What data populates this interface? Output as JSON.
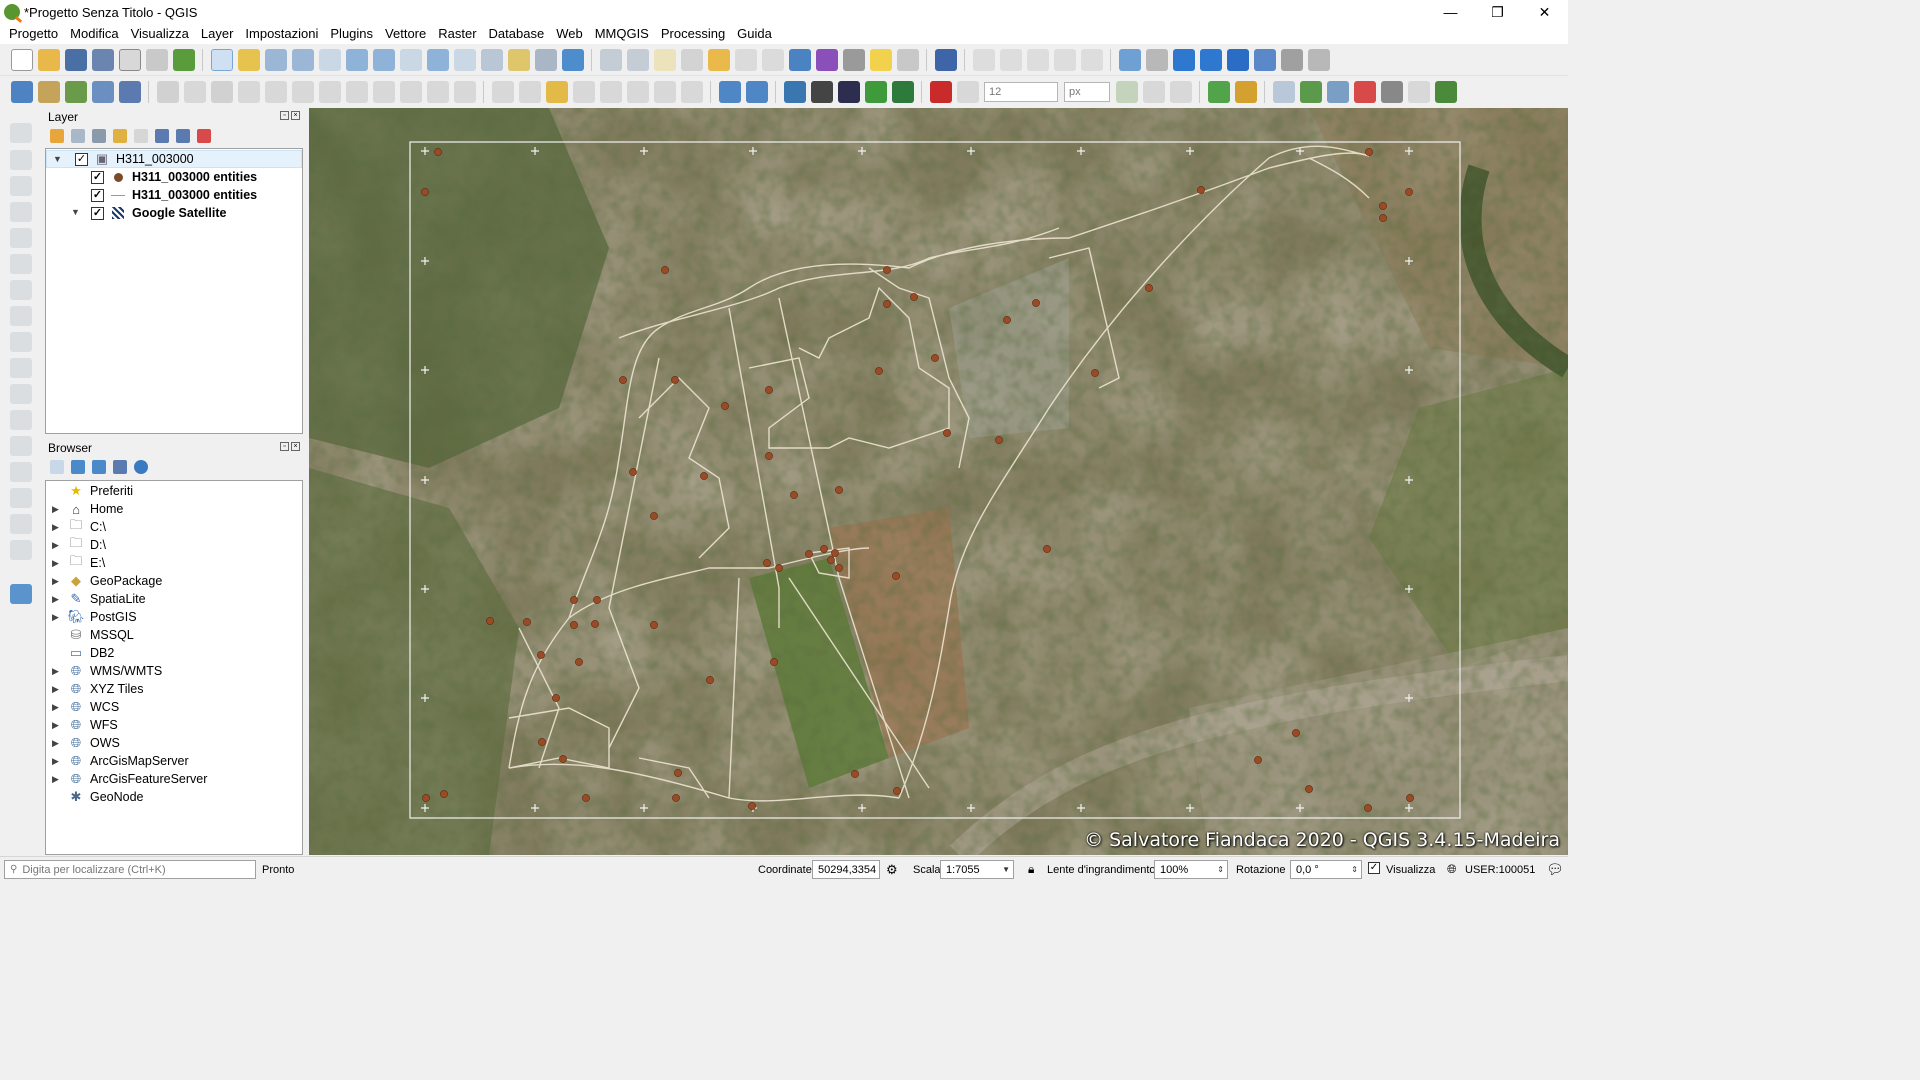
{
  "window": {
    "title": "*Progetto Senza Titolo - QGIS",
    "minimize": "—",
    "restore": "❐",
    "close": "✕"
  },
  "menubar": [
    "Progetto",
    "Modifica",
    "Visualizza",
    "Layer",
    "Impostazioni",
    "Plugins",
    "Vettore",
    "Raster",
    "Database",
    "Web",
    "MMQGIS",
    "Processing",
    "Guida"
  ],
  "toolbar2": {
    "size_value": "12",
    "unit_value": "px"
  },
  "layers_panel": {
    "title": "Layer",
    "items": [
      {
        "label": "H311_003000",
        "checked": true,
        "bold": false,
        "icon": "group-icon"
      },
      {
        "label": "H311_003000 entities",
        "checked": true,
        "bold": true,
        "icon": "point-layer-icon"
      },
      {
        "label": "H311_003000 entities",
        "checked": true,
        "bold": true,
        "icon": "line-layer-icon"
      },
      {
        "label": "Google Satellite",
        "checked": true,
        "bold": true,
        "icon": "raster-layer-icon"
      }
    ]
  },
  "browser_panel": {
    "title": "Browser",
    "items": [
      {
        "label": "Preferiti",
        "icon": "star-icon",
        "expandable": false
      },
      {
        "label": "Home",
        "icon": "home-icon",
        "expandable": true
      },
      {
        "label": "C:\\",
        "icon": "folder-icon",
        "expandable": true
      },
      {
        "label": "D:\\",
        "icon": "folder-icon",
        "expandable": true
      },
      {
        "label": "E:\\",
        "icon": "folder-icon",
        "expandable": true
      },
      {
        "label": "GeoPackage",
        "icon": "geopackage-icon",
        "expandable": true
      },
      {
        "label": "SpatiaLite",
        "icon": "spatialite-icon",
        "expandable": true
      },
      {
        "label": "PostGIS",
        "icon": "postgis-icon",
        "expandable": true
      },
      {
        "label": "MSSQL",
        "icon": "mssql-icon",
        "expandable": false
      },
      {
        "label": "DB2",
        "icon": "db2-icon",
        "expandable": false
      },
      {
        "label": "WMS/WMTS",
        "icon": "globe-icon",
        "expandable": true
      },
      {
        "label": "XYZ Tiles",
        "icon": "globe-icon",
        "expandable": true
      },
      {
        "label": "WCS",
        "icon": "globe-icon",
        "expandable": true
      },
      {
        "label": "WFS",
        "icon": "globe-icon",
        "expandable": true
      },
      {
        "label": "OWS",
        "icon": "globe-icon",
        "expandable": true
      },
      {
        "label": "ArcGisMapServer",
        "icon": "globe-icon",
        "expandable": true
      },
      {
        "label": "ArcGisFeatureServer",
        "icon": "globe-icon",
        "expandable": true
      },
      {
        "label": "GeoNode",
        "icon": "geonode-icon",
        "expandable": false
      }
    ]
  },
  "map": {
    "attribution": "© Salvatore Fiandaca 2020 - QGIS 3.4.15-Madeira"
  },
  "statusbar": {
    "locator_placeholder": "Digita per localizzare (Ctrl+K)",
    "status": "Pronto",
    "coord_label": "Coordinate",
    "coord_value": "50294,3354",
    "scale_label": "Scala",
    "scale_value": "1:7055",
    "magnifier_label": "Lente d'ingrandimento",
    "magnifier_value": "100%",
    "rotation_label": "Rotazione",
    "rotation_value": "0,0 °",
    "render_label": "Visualizza",
    "crs": "USER:100051"
  },
  "colors": {
    "accent": "#589632",
    "point_symbol": "#9b4a26",
    "line_symbol": "#e8e0cc",
    "frame": "#f2f2f2"
  }
}
